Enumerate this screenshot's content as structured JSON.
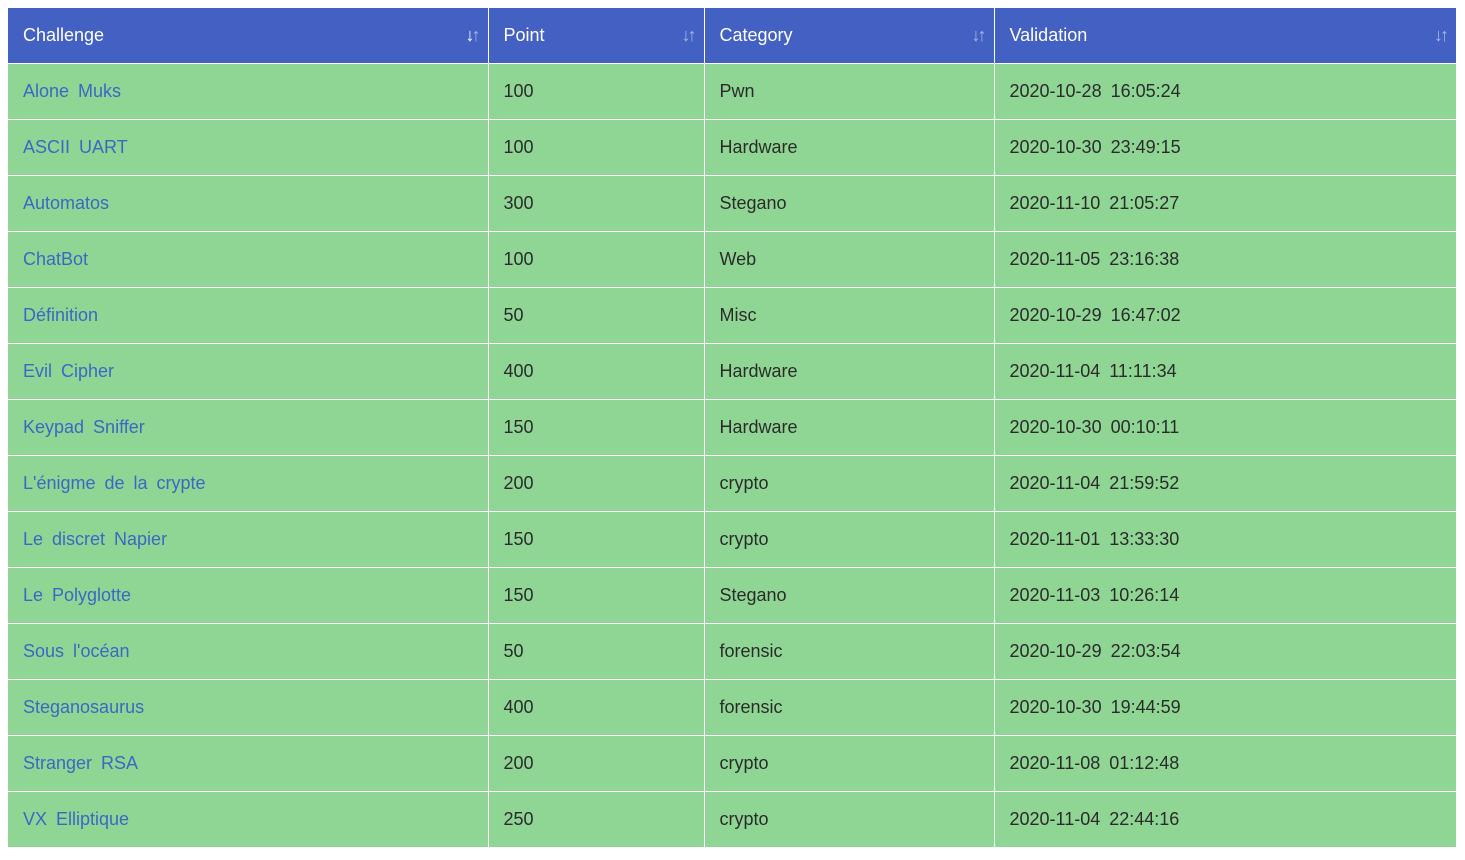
{
  "columns": [
    {
      "label": "Challenge",
      "sorted": true
    },
    {
      "label": "Point",
      "sorted": false
    },
    {
      "label": "Category",
      "sorted": false
    },
    {
      "label": "Validation",
      "sorted": false
    }
  ],
  "icons": {
    "sort": "sort-arrows-icon"
  },
  "colors": {
    "header_bg": "#4361c2",
    "row_bg": "#8fd694",
    "link": "#3b68c4"
  },
  "rows": [
    {
      "challenge": "Alone Muks",
      "point": "100",
      "category": "Pwn",
      "validation": "2020-10-28 16:05:24"
    },
    {
      "challenge": "ASCII UART",
      "point": "100",
      "category": "Hardware",
      "validation": "2020-10-30 23:49:15"
    },
    {
      "challenge": "Automatos",
      "point": "300",
      "category": "Stegano",
      "validation": "2020-11-10 21:05:27"
    },
    {
      "challenge": "ChatBot",
      "point": "100",
      "category": "Web",
      "validation": "2020-11-05 23:16:38"
    },
    {
      "challenge": "Définition",
      "point": "50",
      "category": "Misc",
      "validation": "2020-10-29 16:47:02"
    },
    {
      "challenge": "Evil Cipher",
      "point": "400",
      "category": "Hardware",
      "validation": "2020-11-04 11:11:34"
    },
    {
      "challenge": "Keypad Sniffer",
      "point": "150",
      "category": "Hardware",
      "validation": "2020-10-30 00:10:11"
    },
    {
      "challenge": "L'énigme de la crypte",
      "point": "200",
      "category": "crypto",
      "validation": "2020-11-04 21:59:52"
    },
    {
      "challenge": "Le discret Napier",
      "point": "150",
      "category": "crypto",
      "validation": "2020-11-01 13:33:30"
    },
    {
      "challenge": "Le Polyglotte",
      "point": "150",
      "category": "Stegano",
      "validation": "2020-11-03 10:26:14"
    },
    {
      "challenge": "Sous l'océan",
      "point": "50",
      "category": "forensic",
      "validation": "2020-10-29 22:03:54"
    },
    {
      "challenge": "Steganosaurus",
      "point": "400",
      "category": "forensic",
      "validation": "2020-10-30 19:44:59"
    },
    {
      "challenge": "Stranger RSA",
      "point": "200",
      "category": "crypto",
      "validation": "2020-11-08 01:12:48"
    },
    {
      "challenge": "VX Elliptique",
      "point": "250",
      "category": "crypto",
      "validation": "2020-11-04 22:44:16"
    }
  ]
}
